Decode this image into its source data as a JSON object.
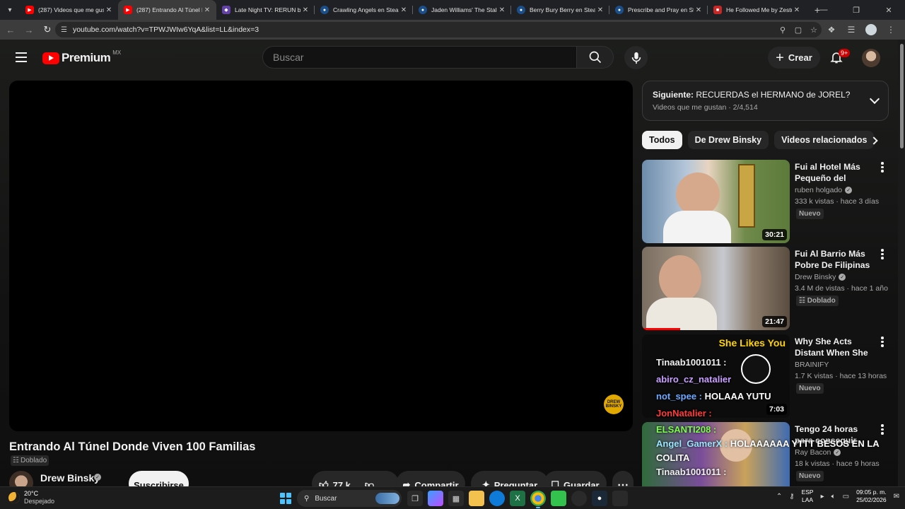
{
  "browser": {
    "tabs": [
      {
        "title": "(287) Videos que me gust",
        "icon": "youtube-icon",
        "active": false
      },
      {
        "title": "(287) Entrando Al Túnel D",
        "icon": "youtube-icon",
        "active": true
      },
      {
        "title": "Late Night TV: RERUN by",
        "icon": "twitch-icon",
        "active": false
      },
      {
        "title": "Crawling Angels en Steam",
        "icon": "steam-icon",
        "active": false
      },
      {
        "title": "Jaden Williams' The Stalk",
        "icon": "steam-icon",
        "active": false
      },
      {
        "title": "Berry Bury Berry en Steam",
        "icon": "steam-icon",
        "active": false
      },
      {
        "title": "Prescribe and Pray en Ste",
        "icon": "steam-icon",
        "active": false
      },
      {
        "title": "He Followed Me by Zestu",
        "icon": "game-icon",
        "active": false
      }
    ],
    "url": "youtube.com/watch?v=TPWJWIw6YqA&list=LL&index=3"
  },
  "youtube": {
    "logo_text": "Premium",
    "country": "MX",
    "search_placeholder": "Buscar",
    "create_label": "Crear",
    "notif_count": "9+",
    "video": {
      "title": "Entrando Al Túnel Donde Viven 100 Familias",
      "dubbed_label": "Doblado",
      "watermark": "DREW BINSKY",
      "channel": "Drew Binsky",
      "subscribe_label": "Suscribirse",
      "likes": "77 k",
      "share_label": "Compartir",
      "ask_label": "Preguntar",
      "save_label": "Guardar"
    },
    "next_up": {
      "prefix": "Siguiente:",
      "title": "RECUERDAS el HERMANO de JOREL?",
      "playlist": "Videos que me gustan · 2/4,514"
    },
    "chips": [
      "Todos",
      "De Drew Binsky",
      "Videos relacionados"
    ],
    "recommendations": [
      {
        "title": "Fui al Hotel Más Pequeño del Mundo",
        "channel": "ruben holgado",
        "verified": true,
        "meta": "333 k vistas · hace 3 días",
        "badge": "Nuevo",
        "duration": "30:21"
      },
      {
        "title": "Fui Al Barrio Más Pobre De Filipinas",
        "channel": "Drew Binsky",
        "verified": true,
        "meta": "3.4 M de vistas · hace 1 año",
        "badge": "Doblado",
        "duration": "21:47",
        "progress": 0.26
      },
      {
        "title": "Why She Acts Distant When She Likes Yo...",
        "channel": "BRAINIFY",
        "verified": false,
        "meta": "1.7 K vistas · hace 13 horas",
        "badge": "Nuevo",
        "duration": "7:03",
        "thumb_text": "She Likes You"
      },
      {
        "title": "Tengo 24 horas para conseguir TODOS lo...",
        "channel": "Ray Bacon",
        "verified": true,
        "meta": "18 k vistas · hace 9 horas",
        "badge": "Nuevo",
        "duration": ""
      }
    ],
    "chat_overlay": [
      {
        "user": "Tinaab1001011 :",
        "text": ""
      },
      {
        "user": "abiro_cz_natalier",
        "text": ""
      },
      {
        "user": "not_spee :",
        "text": "HOLAAA YUTU"
      },
      {
        "user": "JonNatalier :",
        "text": ""
      },
      {
        "user": "ELSANTI208 :",
        "text": ""
      },
      {
        "user": "Angel_GamerX :",
        "text": "HOLAAAAAA YTTT BESOS EN LA COLITA"
      },
      {
        "user": "Tinaab1001011 :",
        "text": ""
      }
    ]
  },
  "taskbar": {
    "temp": "20°C",
    "weather": "Despejado",
    "search_label": "Buscar",
    "lang1": "ESP",
    "lang2": "LAA",
    "time": "09:05 p. m.",
    "date": "25/02/2026"
  },
  "colors": {
    "yt_red": "#ff0000",
    "bg": "#0f0f0f",
    "chip_bg": "#272727",
    "accent_blue": "#4cc2ff"
  }
}
